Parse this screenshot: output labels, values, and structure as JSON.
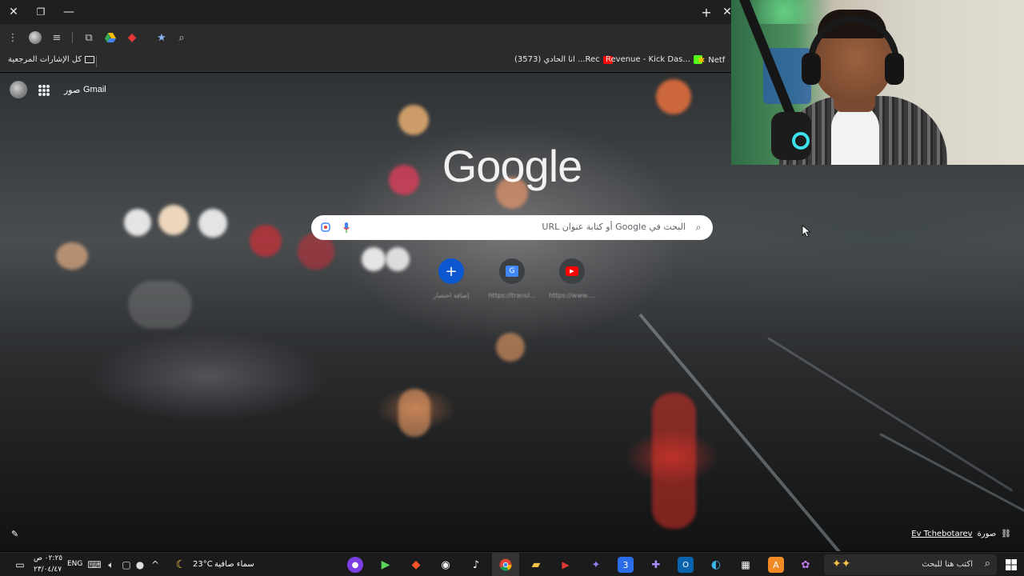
{
  "browser": {
    "window_controls": {
      "close": "✕",
      "restore": "❐",
      "minimize": "—"
    },
    "new_tab": "+",
    "close_tab": "✕"
  },
  "bookmarks": {
    "all_bookmarks": "كل الإشارات المرجعية",
    "items": [
      "(3573) انا الحادي ...Rec",
      "Revenue - Kick Das...",
      "Netf"
    ]
  },
  "page": {
    "links": {
      "gmail": "Gmail",
      "images": "صور"
    },
    "logo": "Google",
    "search_placeholder": "البحث في Google أو كتابة عنوان URL",
    "shortcuts": [
      {
        "label": "إضافة اختصار",
        "icon": "+"
      },
      {
        "label": "https://transl...",
        "icon": "G"
      },
      {
        "label": "https://www....",
        "icon": "▶"
      }
    ],
    "credit_prefix": "صورة",
    "credit_name": "Ev Tchebotarev"
  },
  "taskbar": {
    "search_placeholder": "اكتب هنا للبحث",
    "weather_condition": "سماء صافية",
    "temperature": "23°C",
    "language": "ENG",
    "time": "٠٢:٢٥ ص",
    "date": "٢٣/٠٤/٤٧"
  },
  "colors": {
    "add_shortcut": "#0b57d0",
    "youtube_red": "#ff0000",
    "accent_blue": "#8ab4f8"
  }
}
